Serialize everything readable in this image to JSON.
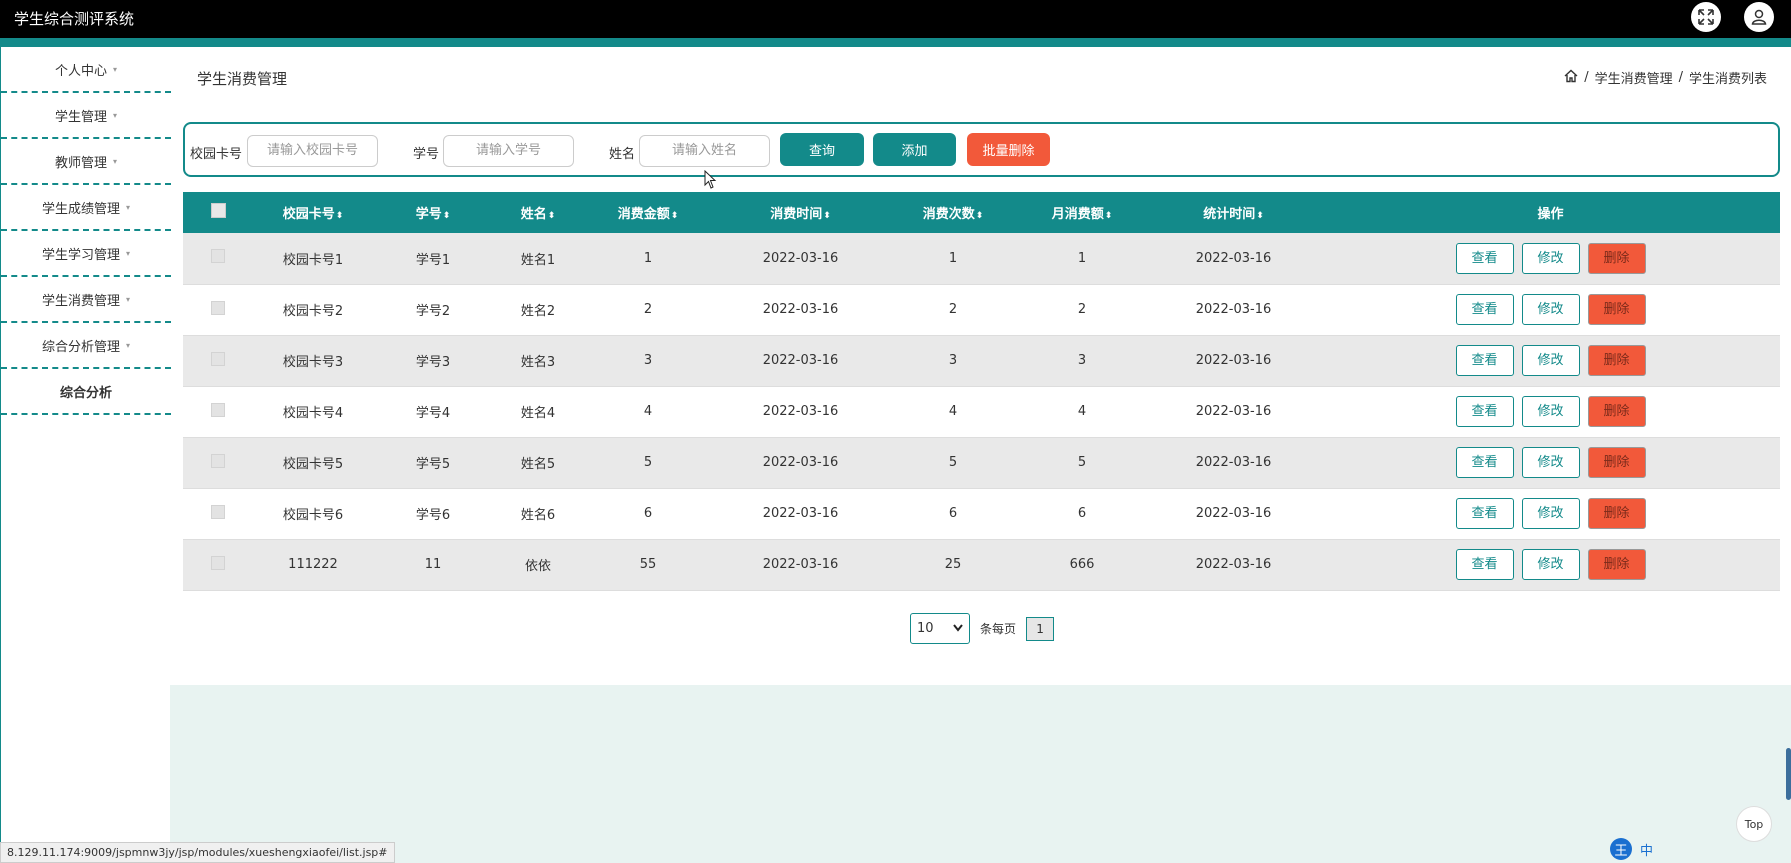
{
  "app": {
    "title": "学生综合测评系统"
  },
  "sidebar": {
    "items": [
      {
        "label": "个人中心",
        "caret": "▾"
      },
      {
        "label": "学生管理",
        "caret": "▾"
      },
      {
        "label": "教师管理",
        "caret": "▾"
      },
      {
        "label": "学生成绩管理",
        "caret": "▾"
      },
      {
        "label": "学生学习管理",
        "caret": "▾"
      },
      {
        "label": "学生消费管理",
        "caret": "▾"
      },
      {
        "label": "综合分析管理",
        "caret": "▾"
      },
      {
        "label": "综合分析"
      }
    ]
  },
  "page": {
    "title": "学生消费管理",
    "breadcrumb": {
      "sep1": "/",
      "item1": "学生消费管理",
      "sep2": "/",
      "item2": "学生消费列表"
    }
  },
  "search": {
    "card_label": "校园卡号",
    "card_placeholder": "请输入校园卡号",
    "id_label": "学号",
    "id_placeholder": "请输入学号",
    "name_label": "姓名",
    "name_placeholder": "请输入姓名",
    "query": "查询",
    "add": "添加",
    "batch_delete": "批量删除"
  },
  "table": {
    "headers": {
      "card": "校园卡号",
      "sid": "学号",
      "name": "姓名",
      "amount": "消费金额",
      "time": "消费时间",
      "count": "消费次数",
      "monthly": "月消费额",
      "stat_time": "统计时间",
      "ops": "操作"
    },
    "sort_glyph": "⬍",
    "actions": {
      "view": "查看",
      "edit": "修改",
      "delete": "删除"
    },
    "rows": [
      {
        "card": "校园卡号1",
        "sid": "学号1",
        "name": "姓名1",
        "amount": "1",
        "time": "2022-03-16",
        "count": "1",
        "monthly": "1",
        "stat_time": "2022-03-16"
      },
      {
        "card": "校园卡号2",
        "sid": "学号2",
        "name": "姓名2",
        "amount": "2",
        "time": "2022-03-16",
        "count": "2",
        "monthly": "2",
        "stat_time": "2022-03-16"
      },
      {
        "card": "校园卡号3",
        "sid": "学号3",
        "name": "姓名3",
        "amount": "3",
        "time": "2022-03-16",
        "count": "3",
        "monthly": "3",
        "stat_time": "2022-03-16"
      },
      {
        "card": "校园卡号4",
        "sid": "学号4",
        "name": "姓名4",
        "amount": "4",
        "time": "2022-03-16",
        "count": "4",
        "monthly": "4",
        "stat_time": "2022-03-16"
      },
      {
        "card": "校园卡号5",
        "sid": "学号5",
        "name": "姓名5",
        "amount": "5",
        "time": "2022-03-16",
        "count": "5",
        "monthly": "5",
        "stat_time": "2022-03-16"
      },
      {
        "card": "校园卡号6",
        "sid": "学号6",
        "name": "姓名6",
        "amount": "6",
        "time": "2022-03-16",
        "count": "6",
        "monthly": "6",
        "stat_time": "2022-03-16"
      },
      {
        "card": "111222",
        "sid": "11",
        "name": "依依",
        "amount": "55",
        "time": "2022-03-16",
        "count": "25",
        "monthly": "666",
        "stat_time": "2022-03-16"
      }
    ]
  },
  "pager": {
    "page_size": "10",
    "per_page_label": "条每页",
    "current_page": "1"
  },
  "status_bar": {
    "url": "8.129.11.174:9009/jspmnw3jy/jsp/modules/xueshengxiaofei/list.jsp#"
  },
  "top_button": "Top",
  "tray": {
    "ime": "王",
    "lang": "中"
  },
  "colors": {
    "accent": "#138a8a",
    "danger": "#f2593a",
    "topbar": "#000000",
    "footer_bg": "#e8f3f1"
  }
}
